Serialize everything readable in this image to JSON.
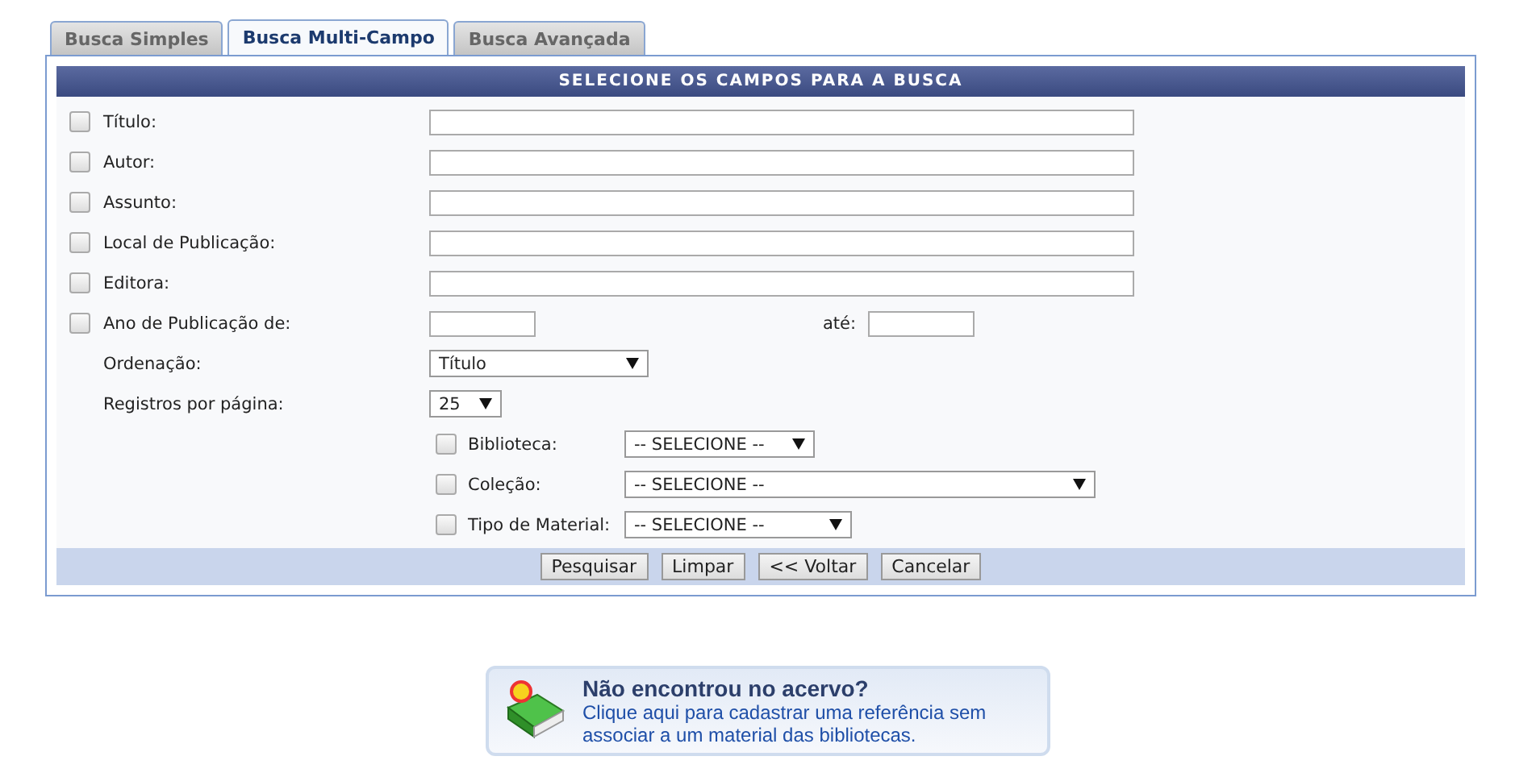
{
  "tabs": [
    {
      "label": "Busca Simples",
      "selected": false
    },
    {
      "label": "Busca Multi-Campo",
      "selected": true
    },
    {
      "label": "Busca Avançada",
      "selected": false
    }
  ],
  "form": {
    "title": "SELECIONE OS CAMPOS PARA A BUSCA",
    "criteria": [
      {
        "kind": "text",
        "label": "Título:",
        "checked": false
      },
      {
        "kind": "text",
        "label": "Autor:",
        "checked": false
      },
      {
        "kind": "text",
        "label": "Assunto:",
        "checked": false
      },
      {
        "kind": "text",
        "label": "Local de Publicação:",
        "checked": false
      },
      {
        "kind": "text",
        "label": "Editora:",
        "checked": false
      },
      {
        "kind": "range",
        "label": "Ano de Publicação de:",
        "to_label": "até:",
        "checked": false
      }
    ],
    "options": [
      {
        "label": "Ordenação:",
        "value": "Título"
      },
      {
        "label": "Registros por página:",
        "value": "25"
      }
    ],
    "filters": [
      {
        "label": "Biblioteca:",
        "value": "-- SELECIONE --",
        "checked": false
      },
      {
        "label": "Coleção:",
        "value": "-- SELECIONE --",
        "checked": false
      },
      {
        "label": "Tipo de Material:",
        "value": "-- SELECIONE --",
        "checked": false
      }
    ],
    "buttons": [
      "Pesquisar",
      "Limpar",
      "<< Voltar",
      "Cancelar"
    ]
  },
  "notice": {
    "title": "Não encontrou no acervo?",
    "text": "Clique aqui para cadastrar uma referência sem associar a um material das bibliotecas."
  }
}
